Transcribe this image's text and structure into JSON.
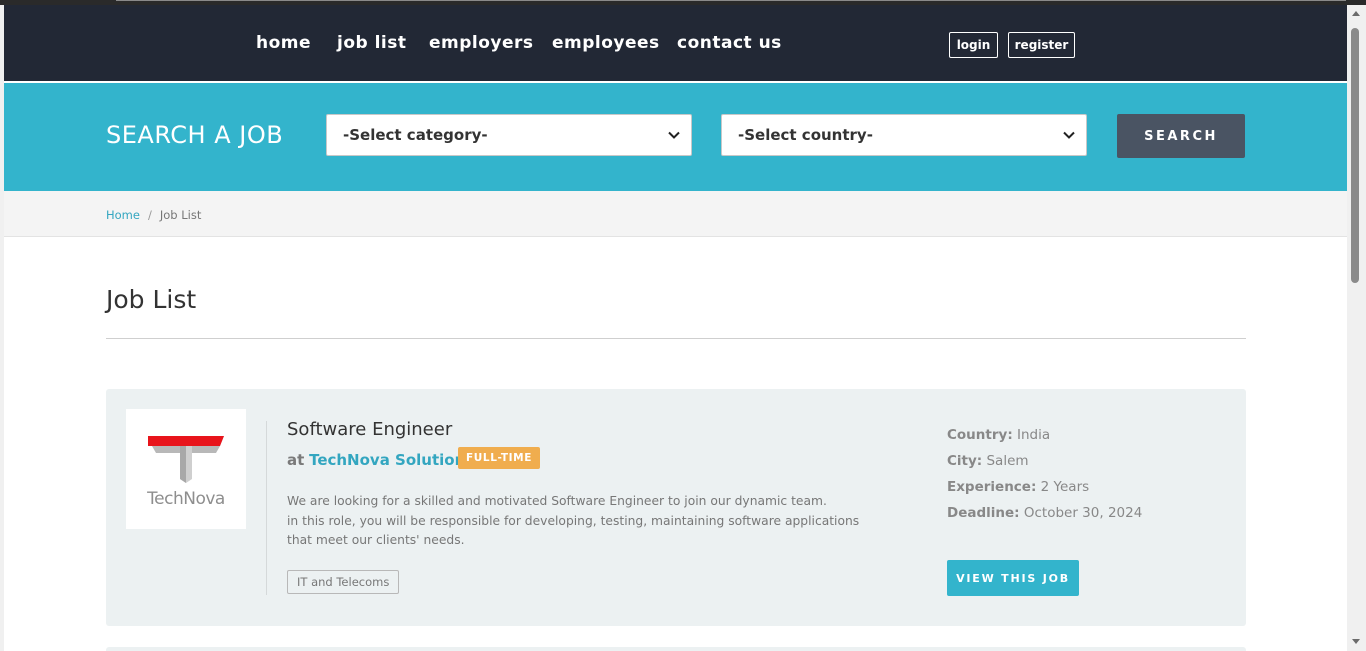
{
  "nav": {
    "links": [
      "home",
      "job list",
      "employers",
      "employees",
      "contact us"
    ],
    "login": "login",
    "register": "register"
  },
  "search": {
    "title": "SEARCH A JOB",
    "category": "-Select category-",
    "country": "-Select country-",
    "button": "SEARCH"
  },
  "breadcrumb": {
    "home": "Home",
    "separator": "/",
    "current": "Job List"
  },
  "page": {
    "title": "Job List"
  },
  "job": {
    "logo_text": "TechNova",
    "title": "Software Engineer",
    "at": "at",
    "company": "TechNova Solutions",
    "type": "FULL-TIME",
    "description_line1": "We are looking for a skilled and motivated Software Engineer to join our dynamic team.",
    "description_line2": "in this role, you will be responsible for developing, testing, maintaining software applications that meet our clients' needs.",
    "tag": "IT and Telecoms",
    "country_label": "Country:",
    "country": "India",
    "city_label": "City:",
    "city": "Salem",
    "experience_label": "Experience:",
    "experience": "2 Years",
    "deadline_label": "Deadline:",
    "deadline": "October 30, 2024",
    "view_button": "VIEW THIS JOB"
  },
  "colors": {
    "navbar": "#222835",
    "accent": "#33b4cc",
    "search_button": "#4a5463",
    "badge": "#f0ad4e",
    "logo_red": "#e8141b"
  }
}
